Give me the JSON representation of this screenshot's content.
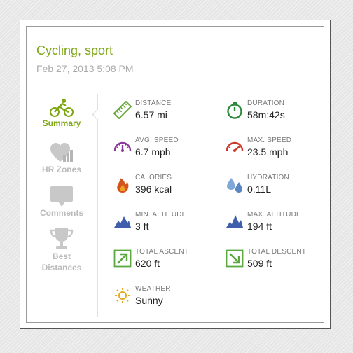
{
  "activity": {
    "title": "Cycling, sport",
    "datetime": "Feb 27, 2013 5:08 PM"
  },
  "sidebar": {
    "items": [
      {
        "label": "Summary",
        "icon": "cyclist-icon",
        "active": true
      },
      {
        "label": "HR Zones",
        "icon": "heart-chart-icon",
        "active": false
      },
      {
        "label": "Comments",
        "icon": "comment-icon",
        "active": false
      },
      {
        "label": "Best Distances",
        "icon": "trophy-icon",
        "active": false
      }
    ]
  },
  "stats": {
    "distance": {
      "label": "DISTANCE",
      "value": "6.57 mi"
    },
    "duration": {
      "label": "DURATION",
      "value": "58m:42s"
    },
    "avg_speed": {
      "label": "AVG. SPEED",
      "value": "6.7 mph"
    },
    "max_speed": {
      "label": "MAX. SPEED",
      "value": "23.5 mph"
    },
    "calories": {
      "label": "CALORIES",
      "value": "396 kcal"
    },
    "hydration": {
      "label": "HYDRATION",
      "value": "0.11L"
    },
    "min_altitude": {
      "label": "MIN. ALTITUDE",
      "value": "3 ft"
    },
    "max_altitude": {
      "label": "MAX. ALTITUDE",
      "value": "194 ft"
    },
    "total_ascent": {
      "label": "TOTAL ASCENT",
      "value": "620 ft"
    },
    "total_descent": {
      "label": "TOTAL DESCENT",
      "value": "509 ft"
    },
    "weather": {
      "label": "WEATHER",
      "value": "Sunny"
    }
  },
  "colors": {
    "accent": "#7da612",
    "inactive": "#bbbbbb",
    "label": "#777777",
    "value": "#222222"
  }
}
